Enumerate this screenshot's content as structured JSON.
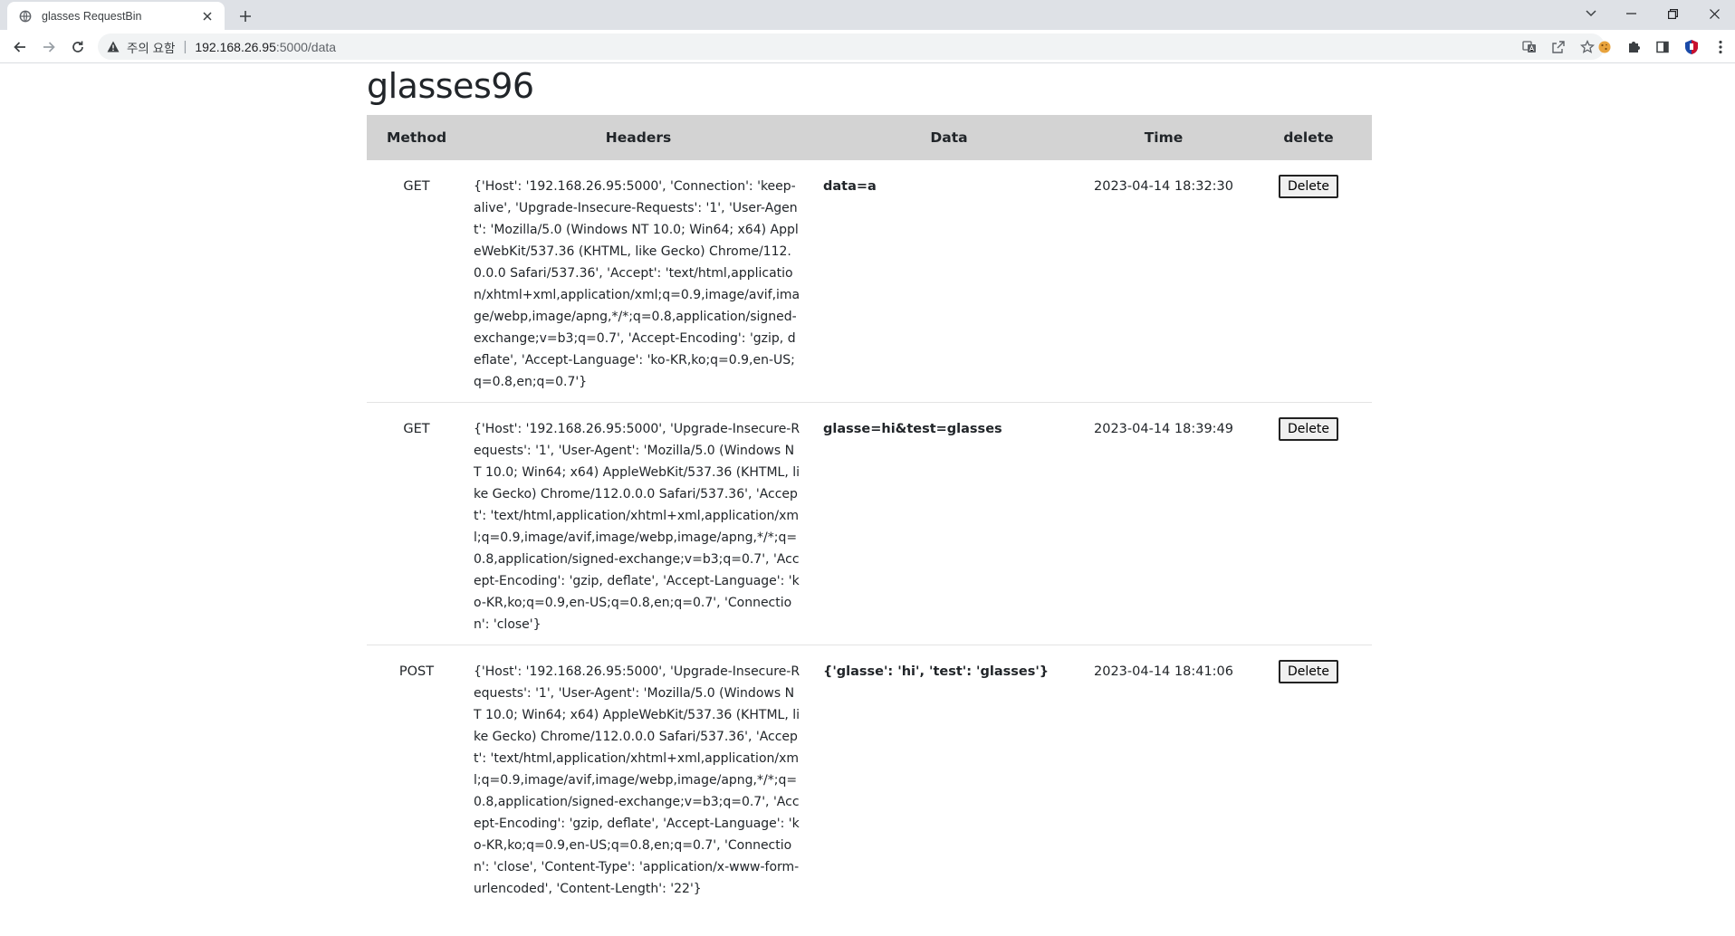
{
  "browser": {
    "tab_title": "glasses RequestBin",
    "security_label": "주의 요함",
    "url_separator": "|",
    "url_host": "192.168.26.95",
    "url_path": ":5000/data"
  },
  "page": {
    "title": "glasses96"
  },
  "table": {
    "columns": {
      "method": "Method",
      "headers": "Headers",
      "data": "Data",
      "time": "Time",
      "delete": "delete"
    },
    "rows": [
      {
        "method": "GET",
        "headers": "{'Host': '192.168.26.95:5000', 'Connection': 'keep-alive', 'Upgrade-Insecure-Requests': '1', 'User-Agent': 'Mozilla/5.0 (Windows NT 10.0; Win64; x64) AppleWebKit/537.36 (KHTML, like Gecko) Chrome/112.0.0.0 Safari/537.36', 'Accept': 'text/html,application/xhtml+xml,application/xml;q=0.9,image/avif,image/webp,image/apng,*/*;q=0.8,application/signed-exchange;v=b3;q=0.7', 'Accept-Encoding': 'gzip, deflate', 'Accept-Language': 'ko-KR,ko;q=0.9,en-US;q=0.8,en;q=0.7'}",
        "data": "data=a",
        "time": "2023-04-14 18:32:30",
        "delete_label": "Delete"
      },
      {
        "method": "GET",
        "headers": "{'Host': '192.168.26.95:5000', 'Upgrade-Insecure-Requests': '1', 'User-Agent': 'Mozilla/5.0 (Windows NT 10.0; Win64; x64) AppleWebKit/537.36 (KHTML, like Gecko) Chrome/112.0.0.0 Safari/537.36', 'Accept': 'text/html,application/xhtml+xml,application/xml;q=0.9,image/avif,image/webp,image/apng,*/*;q=0.8,application/signed-exchange;v=b3;q=0.7', 'Accept-Encoding': 'gzip, deflate', 'Accept-Language': 'ko-KR,ko;q=0.9,en-US;q=0.8,en;q=0.7', 'Connection': 'close'}",
        "data": "glasse=hi&test=glasses",
        "time": "2023-04-14 18:39:49",
        "delete_label": "Delete"
      },
      {
        "method": "POST",
        "headers": "{'Host': '192.168.26.95:5000', 'Upgrade-Insecure-Requests': '1', 'User-Agent': 'Mozilla/5.0 (Windows NT 10.0; Win64; x64) AppleWebKit/537.36 (KHTML, like Gecko) Chrome/112.0.0.0 Safari/537.36', 'Accept': 'text/html,application/xhtml+xml,application/xml;q=0.9,image/avif,image/webp,image/apng,*/*;q=0.8,application/signed-exchange;v=b3;q=0.7', 'Accept-Encoding': 'gzip, deflate', 'Accept-Language': 'ko-KR,ko;q=0.9,en-US;q=0.8,en;q=0.7', 'Connection': 'close', 'Content-Type': 'application/x-www-form-urlencoded', 'Content-Length': '22'}",
        "data": "{'glasse': 'hi', 'test': 'glasses'}",
        "time": "2023-04-14 18:41:06",
        "delete_label": "Delete"
      }
    ]
  },
  "icons": {
    "tab_favicon": "globe-icon",
    "tab_close": "close-icon",
    "new_tab": "plus-icon",
    "tab_search": "chevron-down-icon",
    "minimize": "minimize-icon",
    "restore": "restore-icon",
    "window_close": "close-icon",
    "back": "back-arrow-icon",
    "forward": "forward-arrow-icon",
    "reload": "reload-icon",
    "warning": "warning-triangle-icon",
    "translate": "translate-icon",
    "share": "share-icon",
    "bookmark": "star-icon",
    "ext_cookie": "cookie-icon",
    "extensions": "puzzle-icon",
    "side_panel": "side-panel-icon",
    "profile": "profile-icon",
    "menu": "kebab-menu-icon"
  },
  "colors": {
    "tabstrip": "#dee1e6",
    "table_header": "#d3d3d3",
    "row_divider": "#e3e3e3"
  }
}
